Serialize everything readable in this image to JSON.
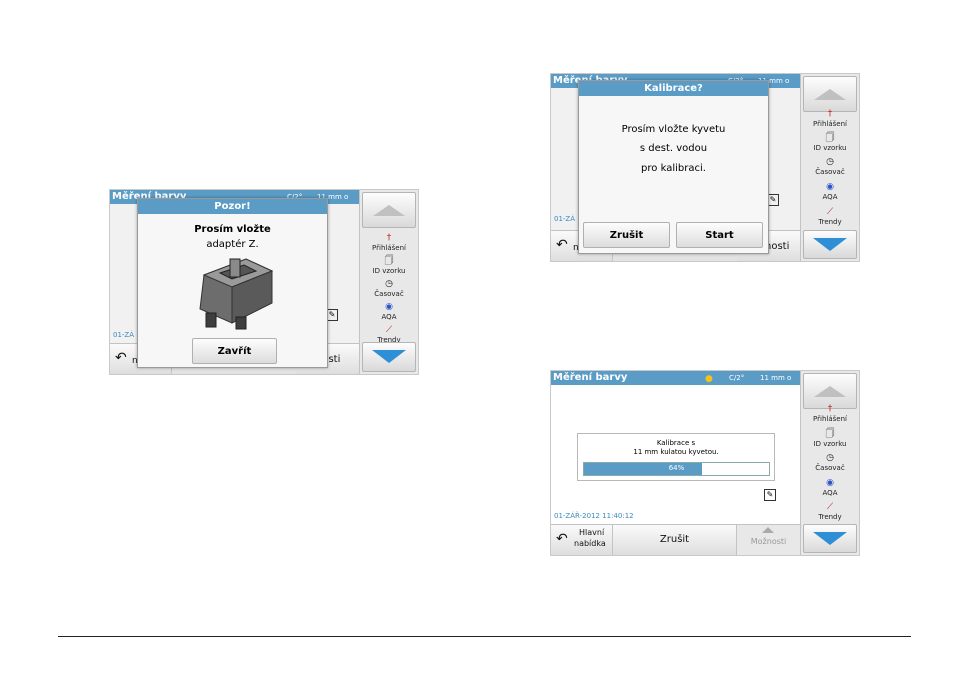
{
  "screen1": {
    "title": "Měření barvy",
    "temp": "C/2°",
    "cuvette": "11 mm o",
    "datetime": "01-ZÁ",
    "dialog": {
      "title": "Pozor!",
      "line1": "Prosím vložte",
      "line2": "adaptér Z.",
      "button": "Zavřít"
    },
    "bottom": {
      "back_icon": "undo-arrow-icon",
      "back_label": "n",
      "options": "nosti"
    }
  },
  "screen2": {
    "title": "Měření barvy",
    "temp": "C/2°",
    "cuvette": "11 mm o",
    "datetime": "01-ZÁ",
    "dialog": {
      "title": "Kalibrace?",
      "line1": "Prosím vložte kyvetu",
      "line2": "s dest. vodou",
      "line3": "pro kalibraci.",
      "cancel": "Zrušit",
      "start": "Start"
    },
    "bottom": {
      "back_label": "n",
      "options": "nosti"
    }
  },
  "screen3": {
    "title": "Měření barvy",
    "temp": "C/2°",
    "cuvette": "11 mm o",
    "datetime": "01-ZÁŘ-2012  11:40:12",
    "progress_line1": "Kalibrace s",
    "progress_line2": "11 mm kulatou kyvetou.",
    "progress_text": "64%",
    "progress_value": 0.64,
    "bottom": {
      "back_line1": "Hlavní",
      "back_line2": "nabídka",
      "cancel": "Zrušit",
      "options": "Možnosti"
    }
  },
  "sidebar": {
    "login": "Přihlášení",
    "sample_id": "ID vzorku",
    "timer": "Časovač",
    "aqa": "AQA",
    "trends": "Trendy"
  },
  "colors": {
    "accent": "#5a9cc6",
    "down_arrow": "#2e8fd6",
    "progress_fill": "#5a9cc6"
  }
}
